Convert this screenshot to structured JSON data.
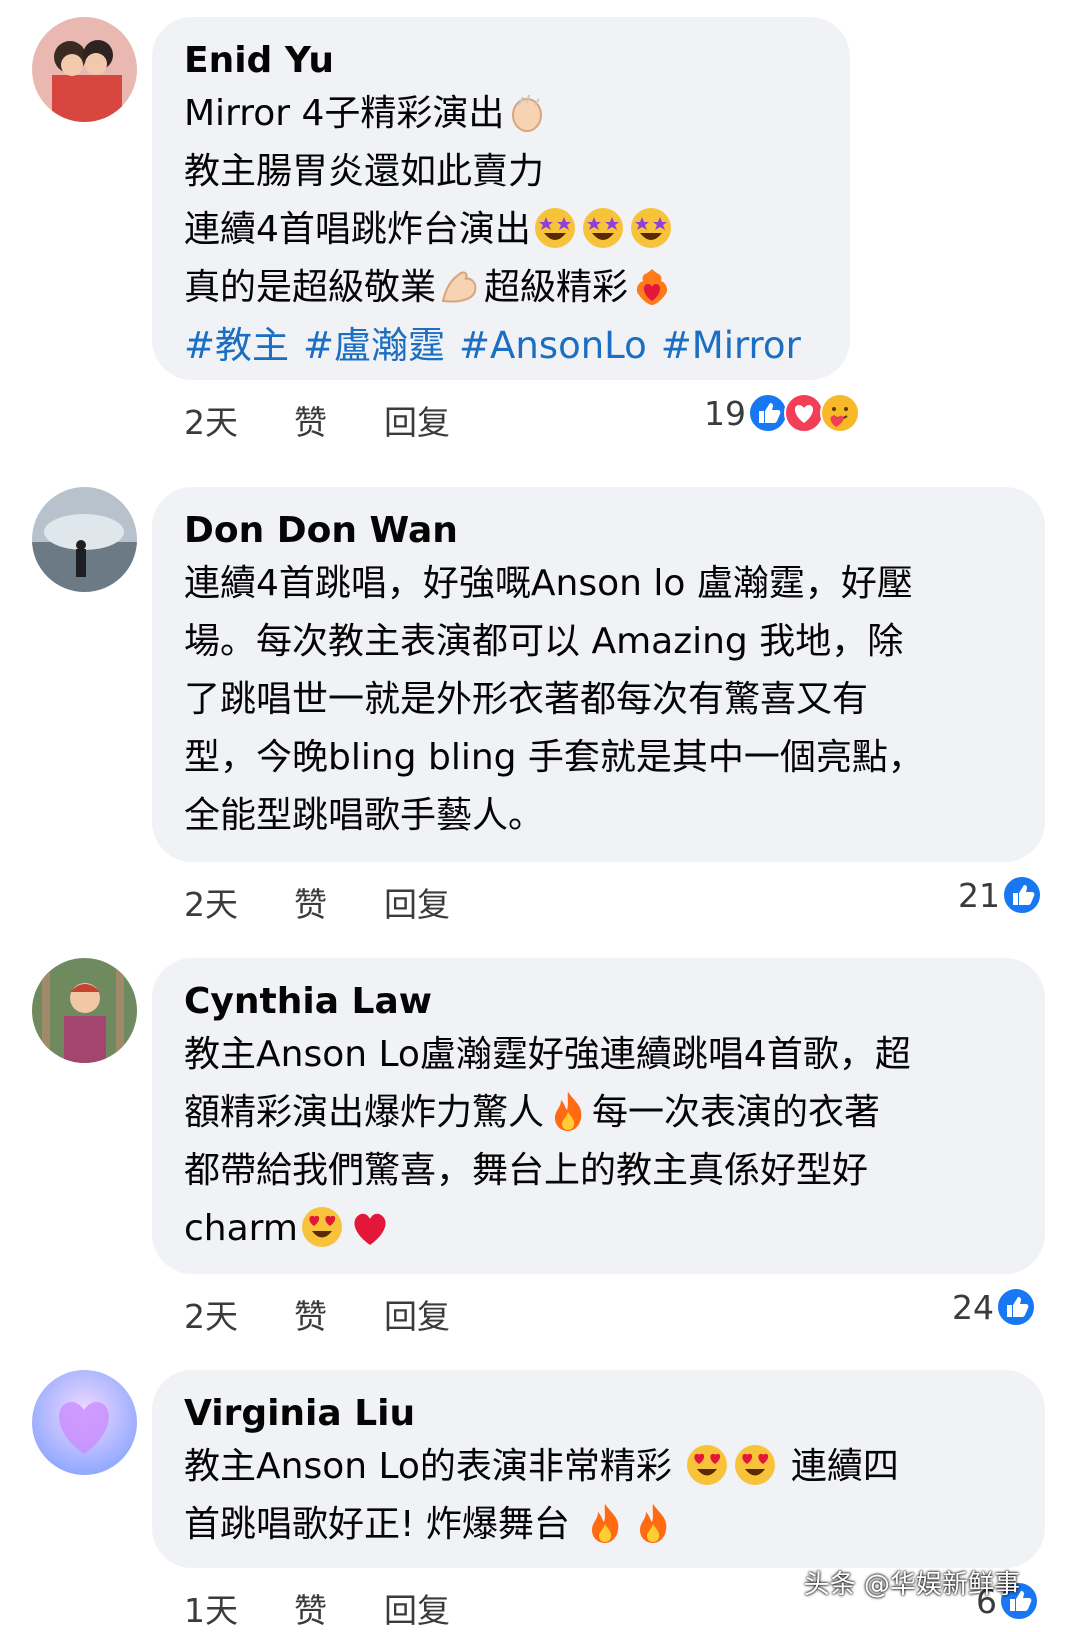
{
  "comments": [
    {
      "author": "Enid Yu",
      "lines": [
        "Mirror 4子精彩演出",
        "教主腸胃炎還如此賣力",
        "連續4首唱跳炸台演出",
        "真的是超級敬業",
        "超級精彩"
      ],
      "hashtags": [
        "#教主",
        "#盧瀚霆",
        "#AnsonLo",
        "#Mirror"
      ],
      "time": "2天",
      "like": "赞",
      "reply": "回复",
      "reactions_count": "19",
      "reaction_icons": [
        "like-icon",
        "love-icon",
        "care-icon"
      ]
    },
    {
      "author": "Don Don Wan",
      "lines": [
        "連續4首跳唱，好強嘅Anson lo 盧瀚霆，好壓",
        "場。每次教主表演都可以 Amazing 我地，除",
        "了跳唱世一就是外形衣著都每次有驚喜又有",
        "型，今晚bling bling 手套就是其中一個亮點，",
        "全能型跳唱歌手藝人。"
      ],
      "time": "2天",
      "like": "赞",
      "reply": "回复",
      "reactions_count": "21",
      "reaction_icons": [
        "like-icon"
      ]
    },
    {
      "author": "Cynthia Law",
      "lines": [
        "教主Anson Lo盧瀚霆好強連續跳唱4首歌，超",
        "額精彩演出爆炸力驚人",
        "每一次表演的衣著",
        "都帶給我們驚喜，舞台上的教主真係好型好",
        "charm"
      ],
      "time": "2天",
      "like": "赞",
      "reply": "回复",
      "reactions_count": "24",
      "reaction_icons": [
        "like-icon"
      ]
    },
    {
      "author": "Virginia Liu",
      "lines": [
        "教主Anson Lo的表演非常精彩",
        "連續四",
        "首跳唱歌好正! 炸爆舞台"
      ],
      "time": "1天",
      "like": "赞",
      "reply": "回复",
      "reactions_count": "6",
      "reaction_icons": [
        "like-icon"
      ]
    }
  ],
  "watermark": "头条 @华娱新鲜事",
  "colors": {
    "bubble": "#f0f2f5",
    "hashtag": "#1b6ec2",
    "like_blue": "#1877f2",
    "love_red": "#f33e58"
  }
}
